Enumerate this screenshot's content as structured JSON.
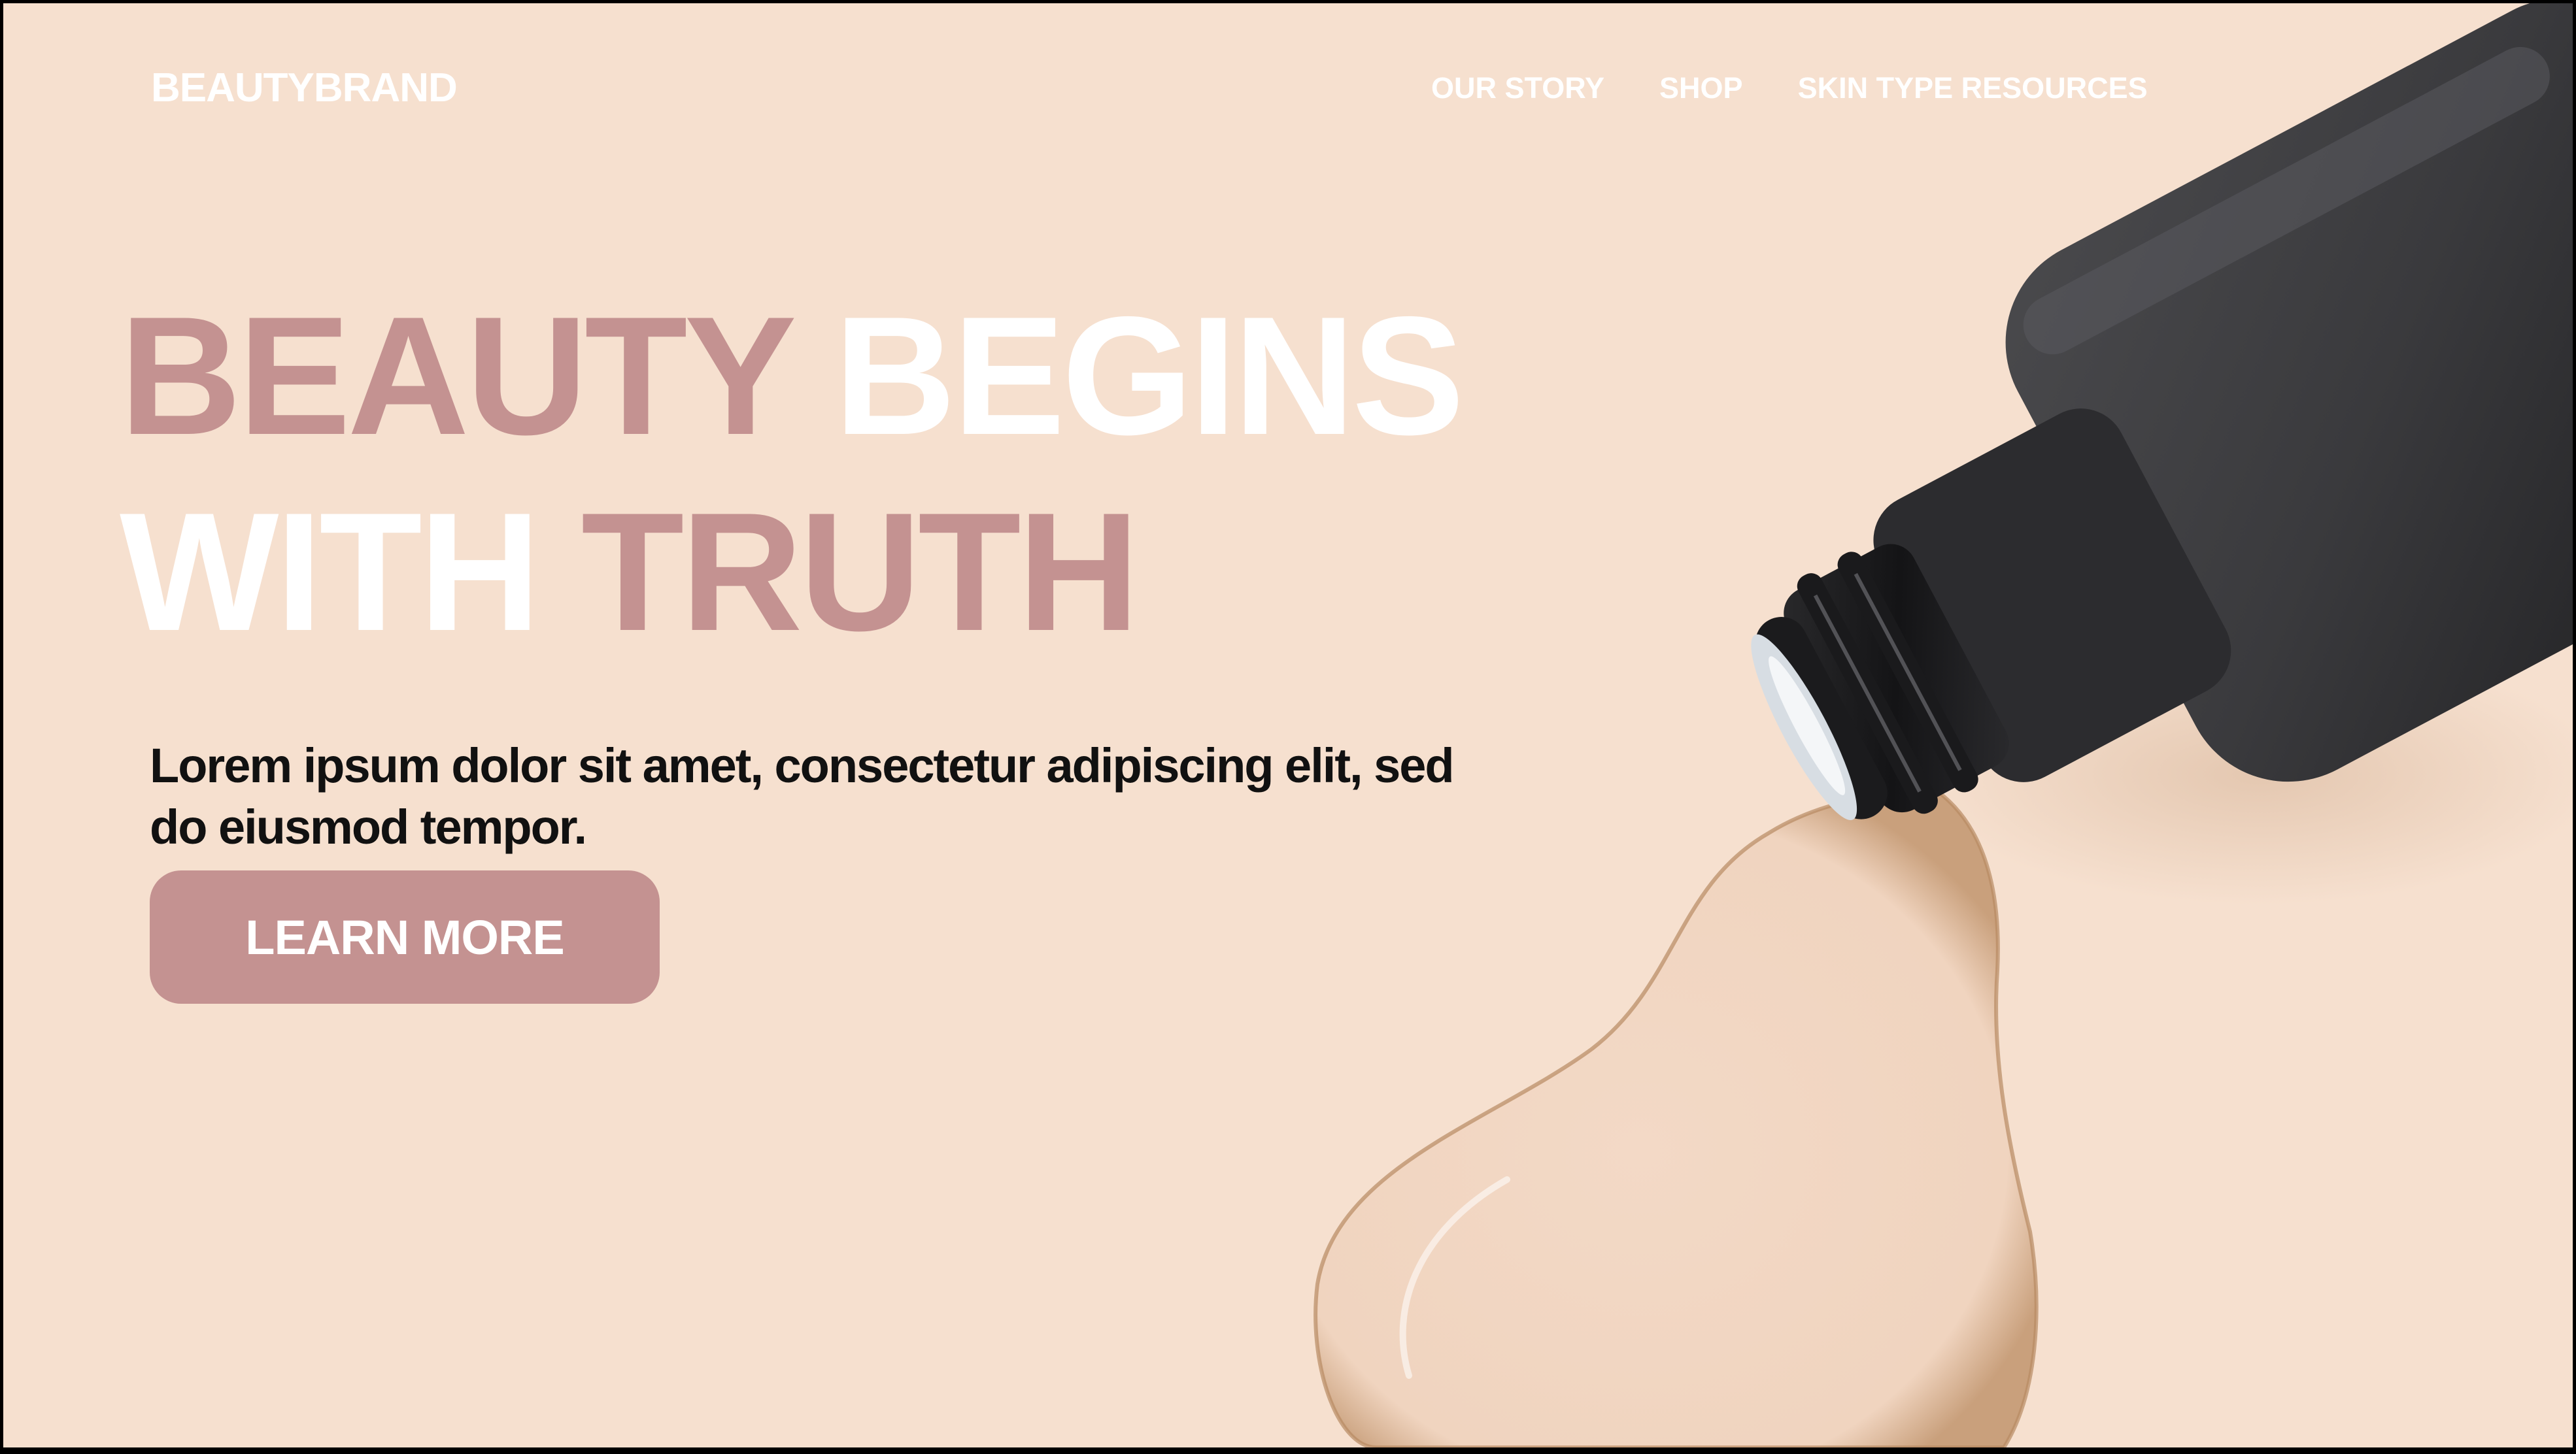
{
  "brand": {
    "name": "BEAUTYBRAND"
  },
  "nav": {
    "items": [
      {
        "label": "OUR STORY"
      },
      {
        "label": "SHOP"
      },
      {
        "label": "SKIN TYPE RESOURCES"
      }
    ]
  },
  "hero": {
    "headline_line1_part1": "BEAUTY",
    "headline_line1_part2": "BEGINS",
    "headline_line2_part1": "WITH",
    "headline_line2_part2": "TRUTH",
    "subtext": "Lorem ipsum dolor sit amet, consectetur adipiscing elit, sed do eiusmod tempor.",
    "cta_label": "LEARN MORE"
  },
  "colors": {
    "background": "#f6e0cf",
    "accent": "#c49291",
    "white": "#ffffff",
    "text": "#111111",
    "bottle": "#2f2f31"
  },
  "icons": {
    "product_image": "foundation-bottle-spill"
  }
}
